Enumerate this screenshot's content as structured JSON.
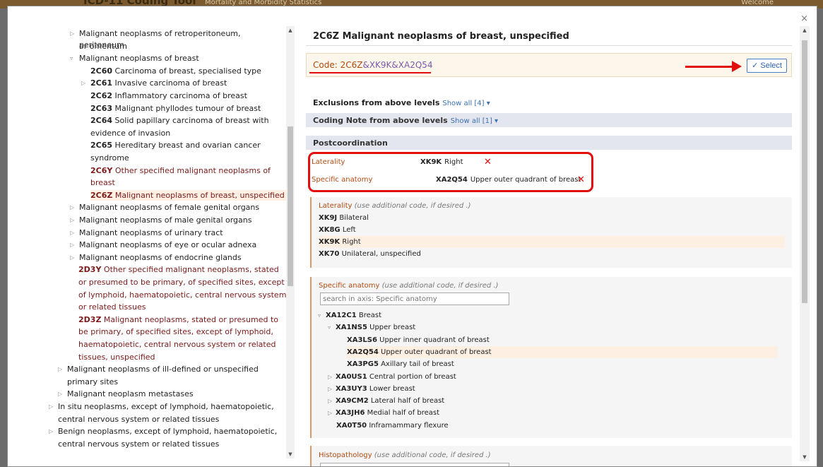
{
  "background": {
    "title": "ICD-11 Coding Tool",
    "subtitle": "Mortality and Morbidity Statistics",
    "right": "Welcome"
  },
  "dialog": {
    "close": "×"
  },
  "tree": {
    "items": [
      {
        "indent": 1,
        "tri": "▷",
        "code": "",
        "text": "Malignant neoplasms of retroperitoneum, peritoneum",
        "red": false
      },
      {
        "indent": 1,
        "tri": "",
        "code": "",
        "text": "or omentum",
        "red": false
      },
      {
        "indent": 1,
        "tri": "▿",
        "code": "",
        "text": "Malignant neoplasms of breast",
        "red": false
      },
      {
        "indent": 2,
        "tri": "",
        "code": "2C60",
        "text": "Carcinoma of breast, specialised type",
        "red": false
      },
      {
        "indent": 2,
        "tri": "▷",
        "code": "2C61",
        "text": "Invasive carcinoma of breast",
        "red": false
      },
      {
        "indent": 2,
        "tri": "",
        "code": "2C62",
        "text": "Inflammatory carcinoma of breast",
        "red": false
      },
      {
        "indent": 2,
        "tri": "",
        "code": "2C63",
        "text": "Malignant phyllodes tumour of breast",
        "red": false
      },
      {
        "indent": 2,
        "tri": "",
        "code": "2C64",
        "text": "Solid papillary carcinoma of breast with",
        "red": false
      },
      {
        "indent": 2,
        "tri": "",
        "code": "",
        "text": "evidence of invasion",
        "red": false,
        "wrap": true
      },
      {
        "indent": 2,
        "tri": "",
        "code": "2C65",
        "text": "Hereditary breast and ovarian cancer",
        "red": false
      },
      {
        "indent": 2,
        "tri": "",
        "code": "",
        "text": "syndrome",
        "red": false,
        "wrap": true
      },
      {
        "indent": 2,
        "tri": "",
        "code": "2C6Y",
        "text": "Other specified malignant neoplasms of",
        "red": true
      },
      {
        "indent": 2,
        "tri": "",
        "code": "",
        "text": "breast",
        "red": true,
        "wrap": true
      },
      {
        "indent": 2,
        "tri": "",
        "code": "2C6Z",
        "text": "Malignant neoplasms of breast, unspecified",
        "red": true,
        "selected": true
      },
      {
        "indent": 1,
        "tri": "▷",
        "code": "",
        "text": "Malignant neoplasms of female genital organs",
        "red": false
      },
      {
        "indent": 1,
        "tri": "▷",
        "code": "",
        "text": "Malignant neoplasms of male genital organs",
        "red": false
      },
      {
        "indent": 1,
        "tri": "▷",
        "code": "",
        "text": "Malignant neoplasms of urinary tract",
        "red": false
      },
      {
        "indent": 1,
        "tri": "▷",
        "code": "",
        "text": "Malignant neoplasms of eye or ocular adnexa",
        "red": false
      },
      {
        "indent": 1,
        "tri": "▷",
        "code": "",
        "text": "Malignant neoplasms of endocrine glands",
        "red": false
      },
      {
        "indent": 1.5,
        "tri": "",
        "code": "2D3Y",
        "text": "Other specified malignant neoplasms, stated",
        "red": true
      },
      {
        "indent": 1.5,
        "tri": "",
        "code": "",
        "text": "or presumed to be primary, of specified sites, except",
        "red": true,
        "wrap": true
      },
      {
        "indent": 1.5,
        "tri": "",
        "code": "",
        "text": "of lymphoid, haematopoietic, central nervous system",
        "red": true,
        "wrap": true
      },
      {
        "indent": 1.5,
        "tri": "",
        "code": "",
        "text": "or related tissues",
        "red": true,
        "wrap": true
      },
      {
        "indent": 1.5,
        "tri": "",
        "code": "2D3Z",
        "text": "Malignant neoplasms, stated or presumed to",
        "red": true
      },
      {
        "indent": 1.5,
        "tri": "",
        "code": "",
        "text": "be primary, of specified sites, except of lymphoid,",
        "red": true,
        "wrap": true
      },
      {
        "indent": 1.5,
        "tri": "",
        "code": "",
        "text": "haematopoietic, central nervous system or related",
        "red": true,
        "wrap": true
      },
      {
        "indent": 1.5,
        "tri": "",
        "code": "",
        "text": "tissues, unspecified",
        "red": true,
        "wrap": true
      },
      {
        "indent": 0.5,
        "tri": "▷",
        "code": "",
        "text": "Malignant neoplasms of ill-defined or unspecified",
        "red": false
      },
      {
        "indent": 0.5,
        "tri": "",
        "code": "",
        "text": "primary sites",
        "red": false
      },
      {
        "indent": 0.5,
        "tri": "▷",
        "code": "",
        "text": "Malignant neoplasm metastases",
        "red": false
      },
      {
        "indent": 0,
        "tri": "▷",
        "code": "",
        "text": "In situ neoplasms, except of lymphoid, haematopoietic,",
        "red": false
      },
      {
        "indent": 0,
        "tri": "",
        "code": "",
        "text": "central nervous system or related tissues",
        "red": false
      },
      {
        "indent": 0,
        "tri": "▷",
        "code": "",
        "text": "Benign neoplasms, except of lymphoid, haematopoietic,",
        "red": false
      },
      {
        "indent": 0,
        "tri": "",
        "code": "",
        "text": "central nervous system or related tissues",
        "red": false
      }
    ]
  },
  "detail": {
    "title": "2C6Z Malignant neoplasms of breast, unspecified",
    "code_label": "Code: ",
    "code_main": "2C6Z",
    "code_amp1": "&",
    "code_ext1": "XK9K",
    "code_amp2": "&",
    "code_ext2": "XA2Q54",
    "select_label": "✓ Select",
    "exclusions": {
      "label": "Exclusions from above levels",
      "link": "Show all [4] ▾"
    },
    "coding_note": {
      "label": "Coding Note from above levels",
      "link": "Show all [1] ▾"
    },
    "postcoordination": {
      "label": "Postcoordination",
      "rows": [
        {
          "axis": "Laterality",
          "code": "XK9K",
          "desc": "Right",
          "remove": "✕"
        },
        {
          "axis": "Specific anatomy",
          "code": "XA2Q54",
          "desc": "Upper outer quadrant of breast",
          "remove": "✕"
        }
      ]
    },
    "laterality_panel": {
      "title": "Laterality",
      "hint": "(use additional code, if desired .)",
      "items": [
        {
          "code": "XK9J",
          "text": "Bilateral"
        },
        {
          "code": "XK8G",
          "text": "Left"
        },
        {
          "code": "XK9K",
          "text": "Right",
          "selected": true
        },
        {
          "code": "XK70",
          "text": "Unilateral, unspecified"
        }
      ]
    },
    "anatomy_panel": {
      "title": "Specific anatomy",
      "hint": "(use additional code, if desired .)",
      "search_placeholder": "search in axis: Specific anatomy",
      "items": [
        {
          "level": 0,
          "tri": "▿",
          "code": "XA12C1",
          "text": "Breast"
        },
        {
          "level": 1,
          "tri": "▿",
          "code": "XA1NS5",
          "text": "Upper breast"
        },
        {
          "level": 2,
          "tri": "",
          "code": "XA3LS6",
          "text": "Upper inner quadrant of breast"
        },
        {
          "level": 2,
          "tri": "",
          "code": "XA2Q54",
          "text": "Upper outer quadrant of breast",
          "selected": true
        },
        {
          "level": 2,
          "tri": "",
          "code": "XA3PG5",
          "text": "Axillary tail of breast"
        },
        {
          "level": 1,
          "tri": "▷",
          "code": "XA0US1",
          "text": "Central portion of breast"
        },
        {
          "level": 1,
          "tri": "▷",
          "code": "XA3UY3",
          "text": "Lower breast"
        },
        {
          "level": 1,
          "tri": "▷",
          "code": "XA9CM2",
          "text": "Lateral half of breast"
        },
        {
          "level": 1,
          "tri": "▷",
          "code": "XA3JH6",
          "text": "Medial half of breast"
        },
        {
          "level": 1,
          "tri": "",
          "code": "XA0T50",
          "text": "Inframammary flexure"
        }
      ]
    },
    "histopathology_panel": {
      "title": "Histopathology",
      "hint": "(use additional code, if desired .)"
    }
  },
  "colors": {
    "accent_red": "#e20d0d",
    "code_orange": "#b04a10",
    "link_blue": "#3a6fb0",
    "selected_bg": "#fdf0e3"
  }
}
